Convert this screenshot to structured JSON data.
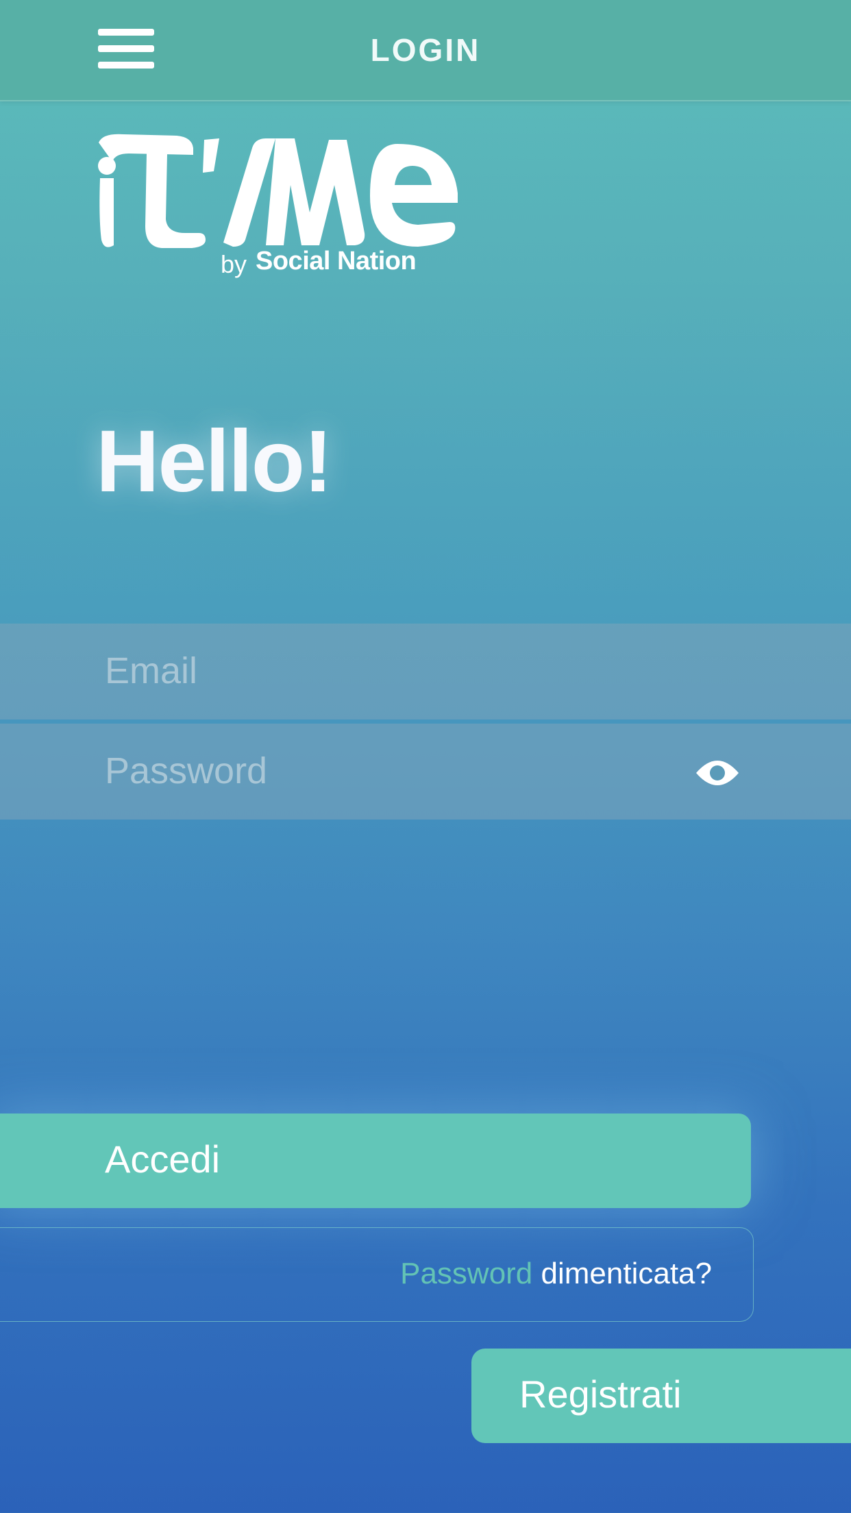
{
  "header": {
    "title": "LOGIN",
    "menu_icon": "hamburger-menu-icon"
  },
  "logo": {
    "wordmark": "iT'sMe",
    "by": "by",
    "brand": "Social Nation"
  },
  "greeting": "Hello!",
  "form": {
    "email_placeholder": "Email",
    "password_placeholder": "Password",
    "eye_icon": "eye-icon"
  },
  "actions": {
    "login_label": "Accedi",
    "forgot_password_word": "Password",
    "forgot_rest": "dimenticata?",
    "register_label": "Registrati"
  },
  "colors": {
    "header_bg": "#57b0a6",
    "button_bg": "#62c6b8",
    "accent_text": "#63c3b5",
    "gradient_top": "#5cbdb9",
    "gradient_bottom": "#2b62b9"
  }
}
